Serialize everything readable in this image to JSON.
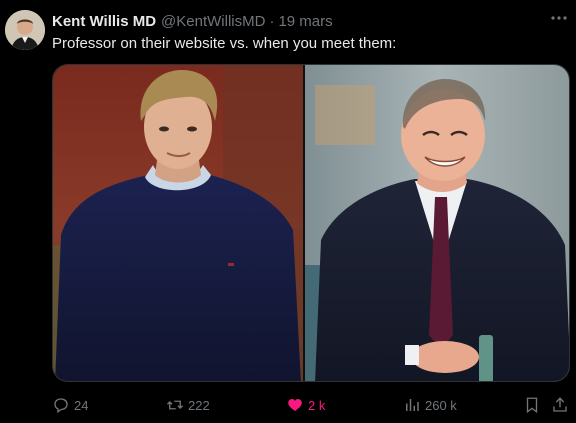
{
  "author": {
    "name": "Kent Willis MD",
    "handle": "@KentWillisMD",
    "separator": "·",
    "date": "19 mars"
  },
  "post": {
    "text": "Professor on their website vs. when you meet them:"
  },
  "actions": {
    "replies": "24",
    "retweets": "222",
    "likes": "2 k",
    "views": "260 k"
  },
  "colors": {
    "background": "#000000",
    "text": "#e7e9ea",
    "secondary": "#71767b",
    "like_active": "#f91880"
  },
  "icons": [
    "more-icon",
    "reply-icon",
    "retweet-icon",
    "heart-icon",
    "views-icon",
    "bookmark-icon",
    "share-icon"
  ]
}
